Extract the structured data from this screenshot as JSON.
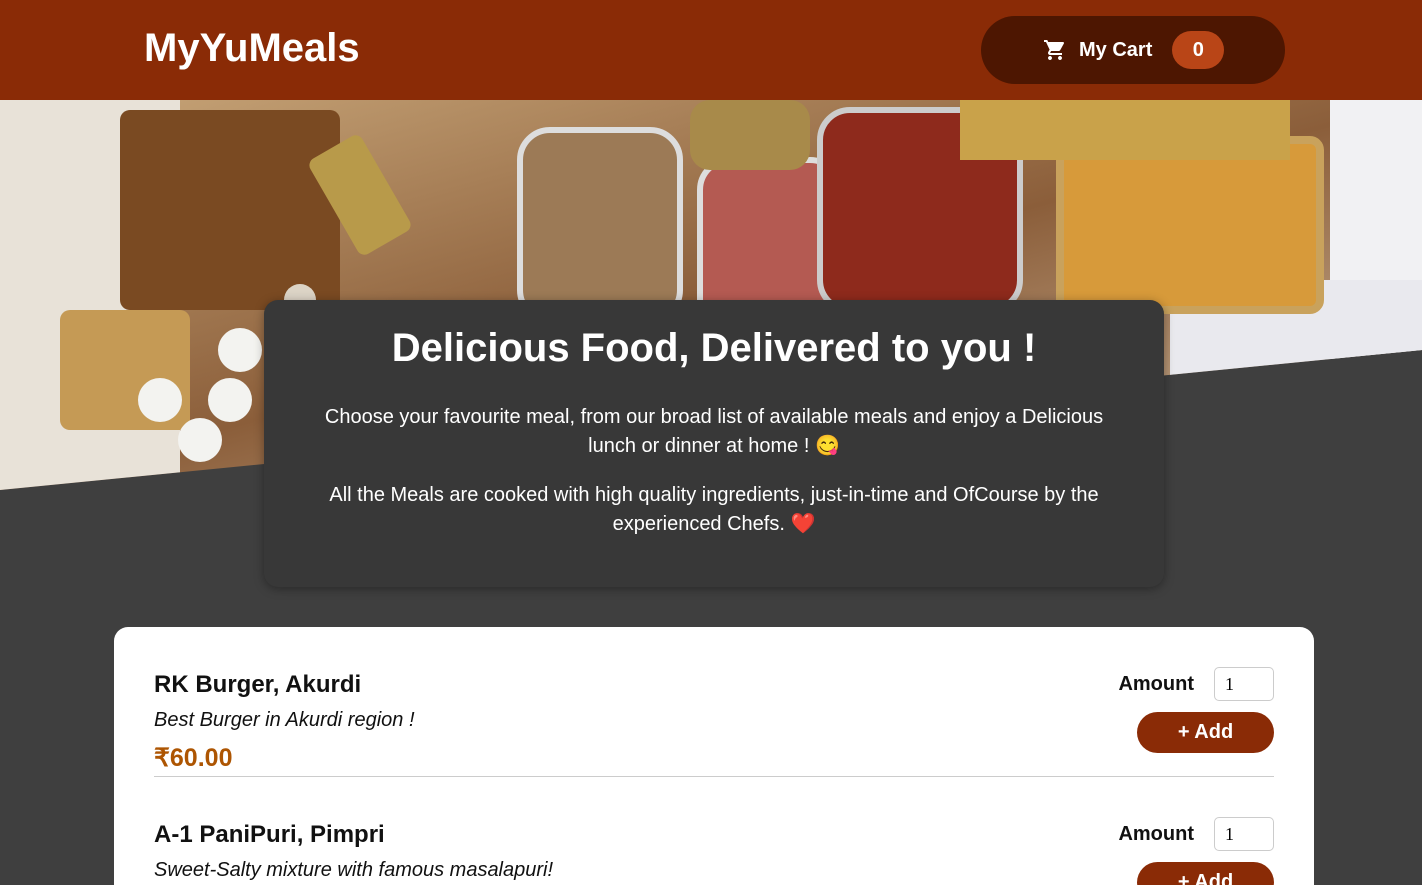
{
  "header": {
    "brand": "MyYuMeals",
    "cart_label": "My Cart",
    "cart_count": "0"
  },
  "intro": {
    "title": "Delicious Food, Delivered to you !",
    "paragraph1": "Choose your favourite meal, from our broad list of available meals and enjoy a Delicious lunch or dinner at home ! 😋",
    "paragraph2": "All the Meals are cooked with high quality ingredients, just-in-time and OfCourse by the experienced Chefs. ❤️"
  },
  "meals": [
    {
      "name": "RK Burger, Akurdi",
      "description": "Best Burger in Akurdi region !",
      "price": "₹60.00",
      "amount_label": "Amount",
      "amount_value": "1",
      "add_label": "+ Add"
    },
    {
      "name": "A-1 PaniPuri, Pimpri",
      "description": "Sweet-Salty mixture with famous masalapuri!",
      "price": "",
      "amount_label": "Amount",
      "amount_value": "1",
      "add_label": "+ Add"
    }
  ],
  "colors": {
    "header": "#8a2b06",
    "cart_button": "#4d1601",
    "badge": "#b94517",
    "background": "#3f3f3f",
    "price": "#ad5502"
  }
}
